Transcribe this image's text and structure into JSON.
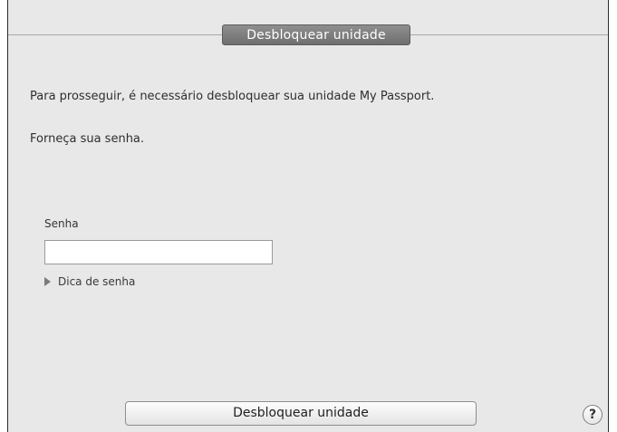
{
  "window": {
    "title": "Desbloquear unidade"
  },
  "content": {
    "message_primary": "Para prosseguir, é necessário desbloquear sua unidade My Passport.",
    "message_secondary": "Forneça sua senha."
  },
  "password": {
    "label": "Senha",
    "value": "",
    "placeholder": ""
  },
  "hint": {
    "label": "Dica de senha",
    "icon": "disclosure-triangle-icon"
  },
  "actions": {
    "unlock_label": "Desbloquear unidade",
    "help_label": "?",
    "help_icon": "help-icon"
  },
  "colors": {
    "title_tab": "#7f7f7f",
    "window_background": "#e8e8e8"
  }
}
